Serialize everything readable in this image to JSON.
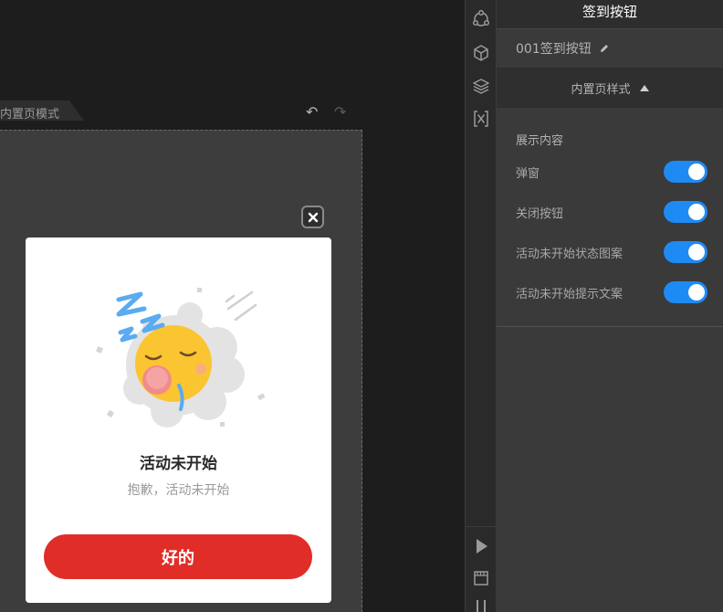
{
  "canvas": {
    "mode_tab": "内置页模式",
    "undo_icon": "undo-icon",
    "redo_icon": "redo-icon"
  },
  "popup": {
    "close_icon": "close-icon",
    "illustration": "sleeping-sun-illustration",
    "title": "活动未开始",
    "subtitle": "抱歉，活动未开始",
    "ok_label": "好的"
  },
  "rail": {
    "icons": [
      "components-icon",
      "cube-icon",
      "layers-icon",
      "variable-icon",
      "play-icon",
      "film-icon"
    ]
  },
  "panel": {
    "header": "签到按钮",
    "component_name": "001签到按钮",
    "section_label": "内置页样式",
    "content_title": "展示内容",
    "toggles": [
      {
        "label": "弹窗",
        "on": true
      },
      {
        "label": "关闭按钮",
        "on": true
      },
      {
        "label": "活动未开始状态图案",
        "on": true
      },
      {
        "label": "活动未开始提示文案",
        "on": true
      }
    ]
  },
  "colors": {
    "accent_red": "#e12d28",
    "toggle_blue": "#1e8bf5",
    "sun_yellow": "#fbc531",
    "zzz_blue": "#5aabf0"
  }
}
